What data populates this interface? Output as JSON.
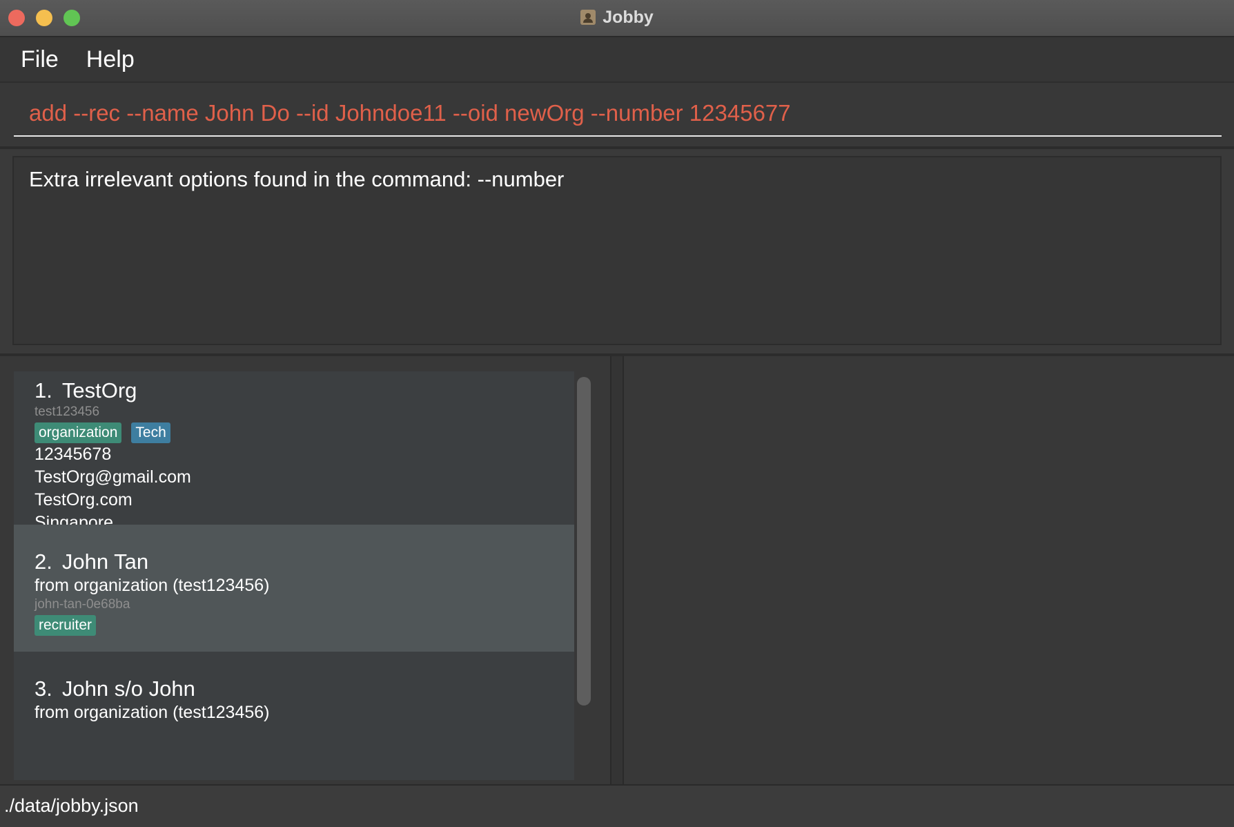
{
  "window": {
    "title": "Jobby"
  },
  "menu": {
    "items": [
      "File",
      "Help"
    ]
  },
  "command": {
    "value": "add --rec --name John Do --id Johndoe11 --oid newOrg --number 12345677"
  },
  "result": {
    "message": "Extra irrelevant options found in the command: --number"
  },
  "contacts": [
    {
      "index": "1.",
      "name": "TestOrg",
      "id": "test123456",
      "tags": [
        "organization",
        "Tech"
      ],
      "phone": "12345678",
      "email": "TestOrg@gmail.com",
      "url": "TestOrg.com",
      "address": "Singapore"
    },
    {
      "index": "2.",
      "name": "John Tan",
      "from": "from organization (test123456)",
      "id": "john-tan-0e68ba",
      "tags": [
        "recruiter"
      ],
      "selected": true
    },
    {
      "index": "3.",
      "name": "John s/o John",
      "from": "from organization (test123456)"
    }
  ],
  "status": {
    "path": "./data/jobby.json"
  },
  "colors": {
    "command_error": "#e0604a",
    "tag_organization": "#3e8b76",
    "tag_tech": "#3e7ea0",
    "selected_card": "#505658"
  }
}
